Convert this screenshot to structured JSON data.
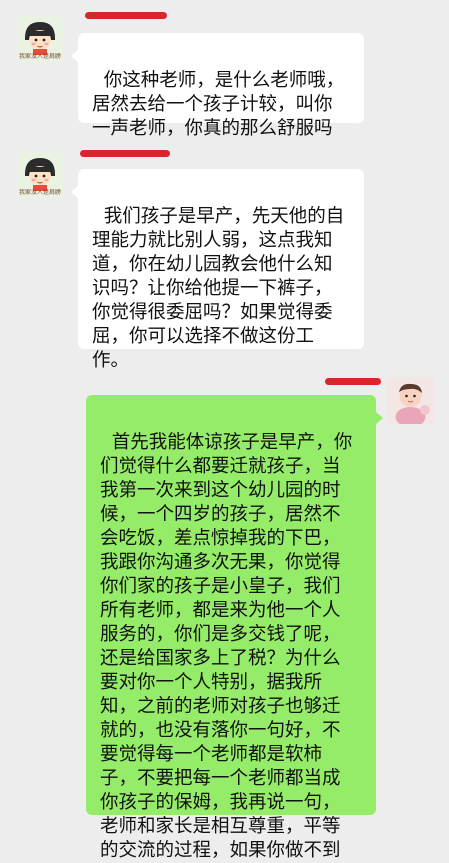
{
  "messages": [
    {
      "side": "left",
      "avatar_caption": "我家没人是肩膀，是的来",
      "text": "你这种老师，是什么老师哦，\n居然去给一个孩子计较，叫你\n一声老师，你真的那么舒服吗"
    },
    {
      "side": "left",
      "avatar_caption": "我家没人是肩膀，是的来",
      "text": "我们孩子是早产，先天他的自\n理能力就比别人弱，这点我知\n道，你在幼儿园教会他什么知\n识吗？让你给他提一下裤子，\n你觉得很委屈吗？如果觉得委\n屈，你可以选择不做这份工\n作。"
    },
    {
      "side": "right",
      "text": "首先我能体谅孩子是早产，你\n们觉得什么都要迁就孩子，当\n我第一次来到这个幼儿园的时\n候，一个四岁的孩子，居然不\n会吃饭，差点惊掉我的下巴，\n我跟你沟通多次无果，你觉得\n你们家的孩子是小皇子，我们\n所有老师，都是来为他一个人\n服务的，你们是多交钱了呢，\n还是给国家多上了税？为什么\n要对你一个人特别，据我所\n知，之前的老师对孩子也够迁\n就的，也没有落你一句好，不\n要觉得每一个老师都是软柿\n子，不要把每一个老师都当成\n你孩子的保姆，我再说一句，\n老师和家长是相互尊重，平等\n的交流的过程，如果你做不到"
    }
  ],
  "colors": {
    "background": "#ededed",
    "left_bubble": "#ffffff",
    "right_bubble": "#95ec69",
    "redaction": "#d9262c"
  }
}
